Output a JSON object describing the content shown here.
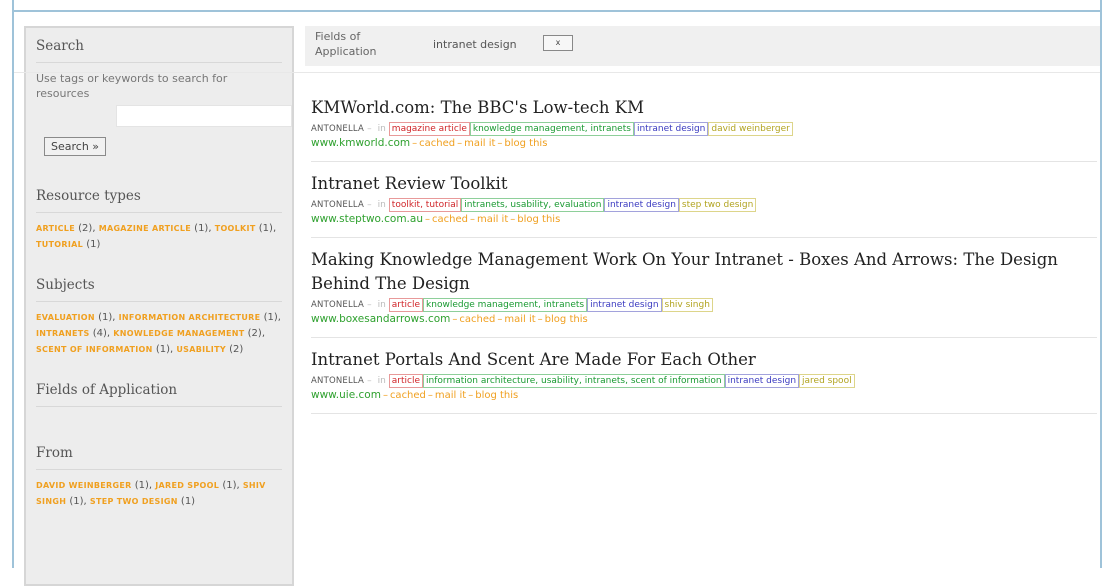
{
  "sidebar": {
    "search_heading": "Search",
    "search_help": "Use tags or keywords to search for resources",
    "search_input_value": "",
    "search_button": "Search »",
    "resource_types_heading": "Resource types",
    "resource_types": [
      {
        "tag": "article",
        "count": "(2),"
      },
      {
        "tag": "magazine article",
        "count": "(1),"
      },
      {
        "tag": "toolkit",
        "count": "(1),"
      },
      {
        "tag": "tutorial",
        "count": "(1)"
      }
    ],
    "subjects_heading": "Subjects",
    "subjects": [
      {
        "tag": "evaluation",
        "count": "(1),"
      },
      {
        "tag": "information architecture",
        "count": "(1),"
      },
      {
        "tag": "intranets",
        "count": "(4),"
      },
      {
        "tag": "knowledge management",
        "count": "(2),"
      },
      {
        "tag": "scent of information",
        "count": "(1),"
      },
      {
        "tag": "usability",
        "count": "(2)"
      }
    ],
    "fields_heading": "Fields of Application",
    "from_heading": "From",
    "from": [
      {
        "tag": "david weinberger",
        "count": "(1),"
      },
      {
        "tag": "jared spool",
        "count": "(1),"
      },
      {
        "tag": "shiv singh",
        "count": "(1),"
      },
      {
        "tag": "step two design",
        "count": "(1)"
      }
    ]
  },
  "filter": {
    "label": "Fields of Application",
    "value": "intranet design",
    "remove": "x"
  },
  "meta_text": {
    "in": "in",
    "cached": "cached",
    "mail": "mail it",
    "blog": "blog this",
    "dash": "–"
  },
  "results": [
    {
      "title": "KMWorld.com: The BBC's Low-tech KM",
      "user": "ANTONELLA",
      "type": "magazine article",
      "subjects": "knowledge management, intranets",
      "field": "intranet design",
      "from": "david weinberger",
      "url": "www.kmworld.com"
    },
    {
      "title": "Intranet Review Toolkit",
      "user": "ANTONELLA",
      "type": "toolkit, tutorial",
      "subjects": "intranets, usability, evaluation",
      "field": "intranet design",
      "from": "step two design",
      "url": "www.steptwo.com.au"
    },
    {
      "title": "Making Knowledge Management Work On Your Intranet - Boxes And Arrows: The Design Behind The Design",
      "user": "ANTONELLA",
      "type": "article",
      "subjects": "knowledge management, intranets",
      "field": "intranet design",
      "from": "shiv singh",
      "url": "www.boxesandarrows.com"
    },
    {
      "title": "Intranet Portals And Scent Are Made For Each Other",
      "user": "ANTONELLA",
      "type": "article",
      "subjects": "information architecture, usability, intranets, scent of information",
      "field": "intranet design",
      "from": "jared spool",
      "url": "www.uie.com"
    }
  ],
  "colors": {
    "tag_orange": "#f0a020",
    "url_green": "#2fa12f",
    "tag_red": "#d0262a",
    "tag_green": "#1a9a32",
    "tag_blue": "#3b3bc0",
    "tag_yellow": "#b2a421",
    "frame_blue": "#9fc3d9"
  }
}
